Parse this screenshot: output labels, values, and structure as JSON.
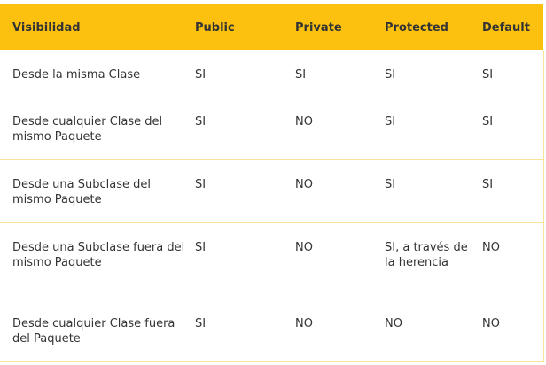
{
  "table": {
    "headers": [
      "Visibilidad",
      "Public",
      "Private",
      "Protected",
      "Default"
    ],
    "rows": [
      [
        "Desde la misma Clase",
        "SI",
        "SI",
        "SI",
        "SI"
      ],
      [
        "Desde cualquier Clase del mismo Paquete",
        "SI",
        "NO",
        "SI",
        "SI"
      ],
      [
        "Desde una Subclase del mismo Paquete",
        "SI",
        "NO",
        "SI",
        "SI"
      ],
      [
        "Desde una Subclase fuera del mismo Paquete",
        "SI",
        "NO",
        "SI, a través de la herencia",
        "NO"
      ],
      [
        "Desde cualquier Clase fuera del Paquete",
        "SI",
        "NO",
        "NO",
        "NO"
      ]
    ]
  },
  "colors": {
    "header_bg": "#fcc10f",
    "row_border": "#fbe39a",
    "text": "#333333"
  }
}
